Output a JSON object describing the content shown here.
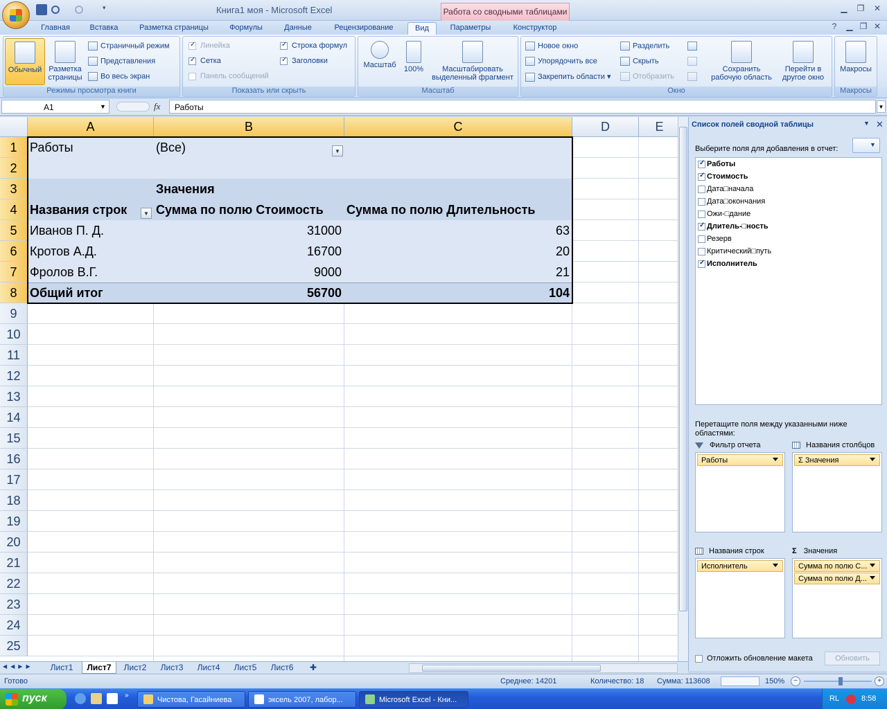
{
  "window": {
    "title": "Книга1 моя - Microsoft Excel",
    "context_tab_title": "Работа со сводными таблицами"
  },
  "tabs": [
    "Главная",
    "Вставка",
    "Разметка страницы",
    "Формулы",
    "Данные",
    "Рецензирование",
    "Вид",
    "Параметры",
    "Конструктор"
  ],
  "active_tab": "Вид",
  "ribbon": {
    "views": {
      "normal": "Обычный",
      "page_layout": "Разметка страницы",
      "page_break": "Страничный режим",
      "custom_views": "Представления",
      "full_screen": "Во весь экран",
      "label": "Режимы просмотра книги"
    },
    "show_hide": {
      "ruler": "Линейка",
      "gridlines": "Сетка",
      "message_bar": "Панель сообщений",
      "formula_bar": "Строка формул",
      "headings": "Заголовки",
      "label": "Показать или скрыть"
    },
    "zoom": {
      "zoom": "Масштаб",
      "zoom100": "100%",
      "zoom_selection": "Масштабировать выделенный фрагмент",
      "label": "Масштаб"
    },
    "window": {
      "new_window": "Новое окно",
      "arrange_all": "Упорядочить все",
      "freeze_panes": "Закрепить области",
      "split": "Разделить",
      "hide": "Скрыть",
      "unhide": "Отобразить",
      "save_workspace": "Сохранить рабочую область",
      "switch_windows": "Перейти в другое окно",
      "label": "Окно"
    },
    "macros": {
      "macros": "Макросы",
      "label": "Макросы"
    }
  },
  "formula_bar": {
    "name_box": "A1",
    "fx": "fx",
    "content": "Работы"
  },
  "columns": [
    "A",
    "B",
    "C",
    "D",
    "E"
  ],
  "rows": [
    "1",
    "2",
    "3",
    "4",
    "5",
    "6",
    "7",
    "8",
    "9",
    "10",
    "11",
    "12",
    "13",
    "14",
    "15",
    "16",
    "17",
    "18",
    "19",
    "20",
    "21",
    "22",
    "23",
    "24",
    "25"
  ],
  "pivot": {
    "filter_label": "Работы",
    "filter_value": "(Все)",
    "values_label": "Значения",
    "row_labels_header": "Названия строк",
    "col1_header": "Сумма по полю Стоимость",
    "col2_header": "Сумма по полю Длительность",
    "rows": [
      {
        "name": "Иванов П. Д.",
        "cost": "31000",
        "duration": "63"
      },
      {
        "name": "Кротов А.Д.",
        "cost": "16700",
        "duration": "20"
      },
      {
        "name": "Фролов В.Г.",
        "cost": "9000",
        "duration": "21"
      }
    ],
    "total": {
      "name": "Общий итог",
      "cost": "56700",
      "duration": "104"
    }
  },
  "field_list": {
    "title": "Список полей сводной таблицы",
    "choose_prompt": "Выберите поля для добавления в отчет:",
    "fields": [
      {
        "name": "Работы",
        "checked": true
      },
      {
        "name": "Стоимость",
        "checked": true
      },
      {
        "name": "Дата□начала",
        "checked": false
      },
      {
        "name": "Дата□окончания",
        "checked": false
      },
      {
        "name": "Ожи-□дание",
        "checked": false
      },
      {
        "name": "Длитель-□ность",
        "checked": true
      },
      {
        "name": "Резерв",
        "checked": false
      },
      {
        "name": "Критический□путь",
        "checked": false
      },
      {
        "name": "Исполнитель",
        "checked": true
      }
    ],
    "drag_prompt": "Перетащите поля между указанными ниже областями:",
    "report_filter_label": "Фильтр отчета",
    "column_labels_label": "Названия столбцов",
    "row_labels_label": "Названия строк",
    "values_label": "Значения",
    "report_filter_items": [
      "Работы"
    ],
    "column_items": [
      "Σ Значения"
    ],
    "row_items": [
      "Исполнитель"
    ],
    "value_items": [
      "Сумма по полю С...",
      "Сумма по полю Д..."
    ],
    "defer_update": "Отложить обновление макета",
    "update_button": "Обновить"
  },
  "sheet_tabs": [
    "Лист1",
    "Лист7",
    "Лист2",
    "Лист3",
    "Лист4",
    "Лист5",
    "Лист6"
  ],
  "active_sheet": "Лист7",
  "status": {
    "ready": "Готово",
    "average": "Среднее: 14201",
    "count": "Количество: 18",
    "sum": "Сумма: 113608",
    "zoom": "150%"
  },
  "taskbar": {
    "start": "пуск",
    "tasks": [
      "Чистова, Гасайниева",
      "эксель 2007, лабор...",
      "Microsoft Excel - Кни..."
    ],
    "lang": "RL",
    "time": "8:58"
  }
}
